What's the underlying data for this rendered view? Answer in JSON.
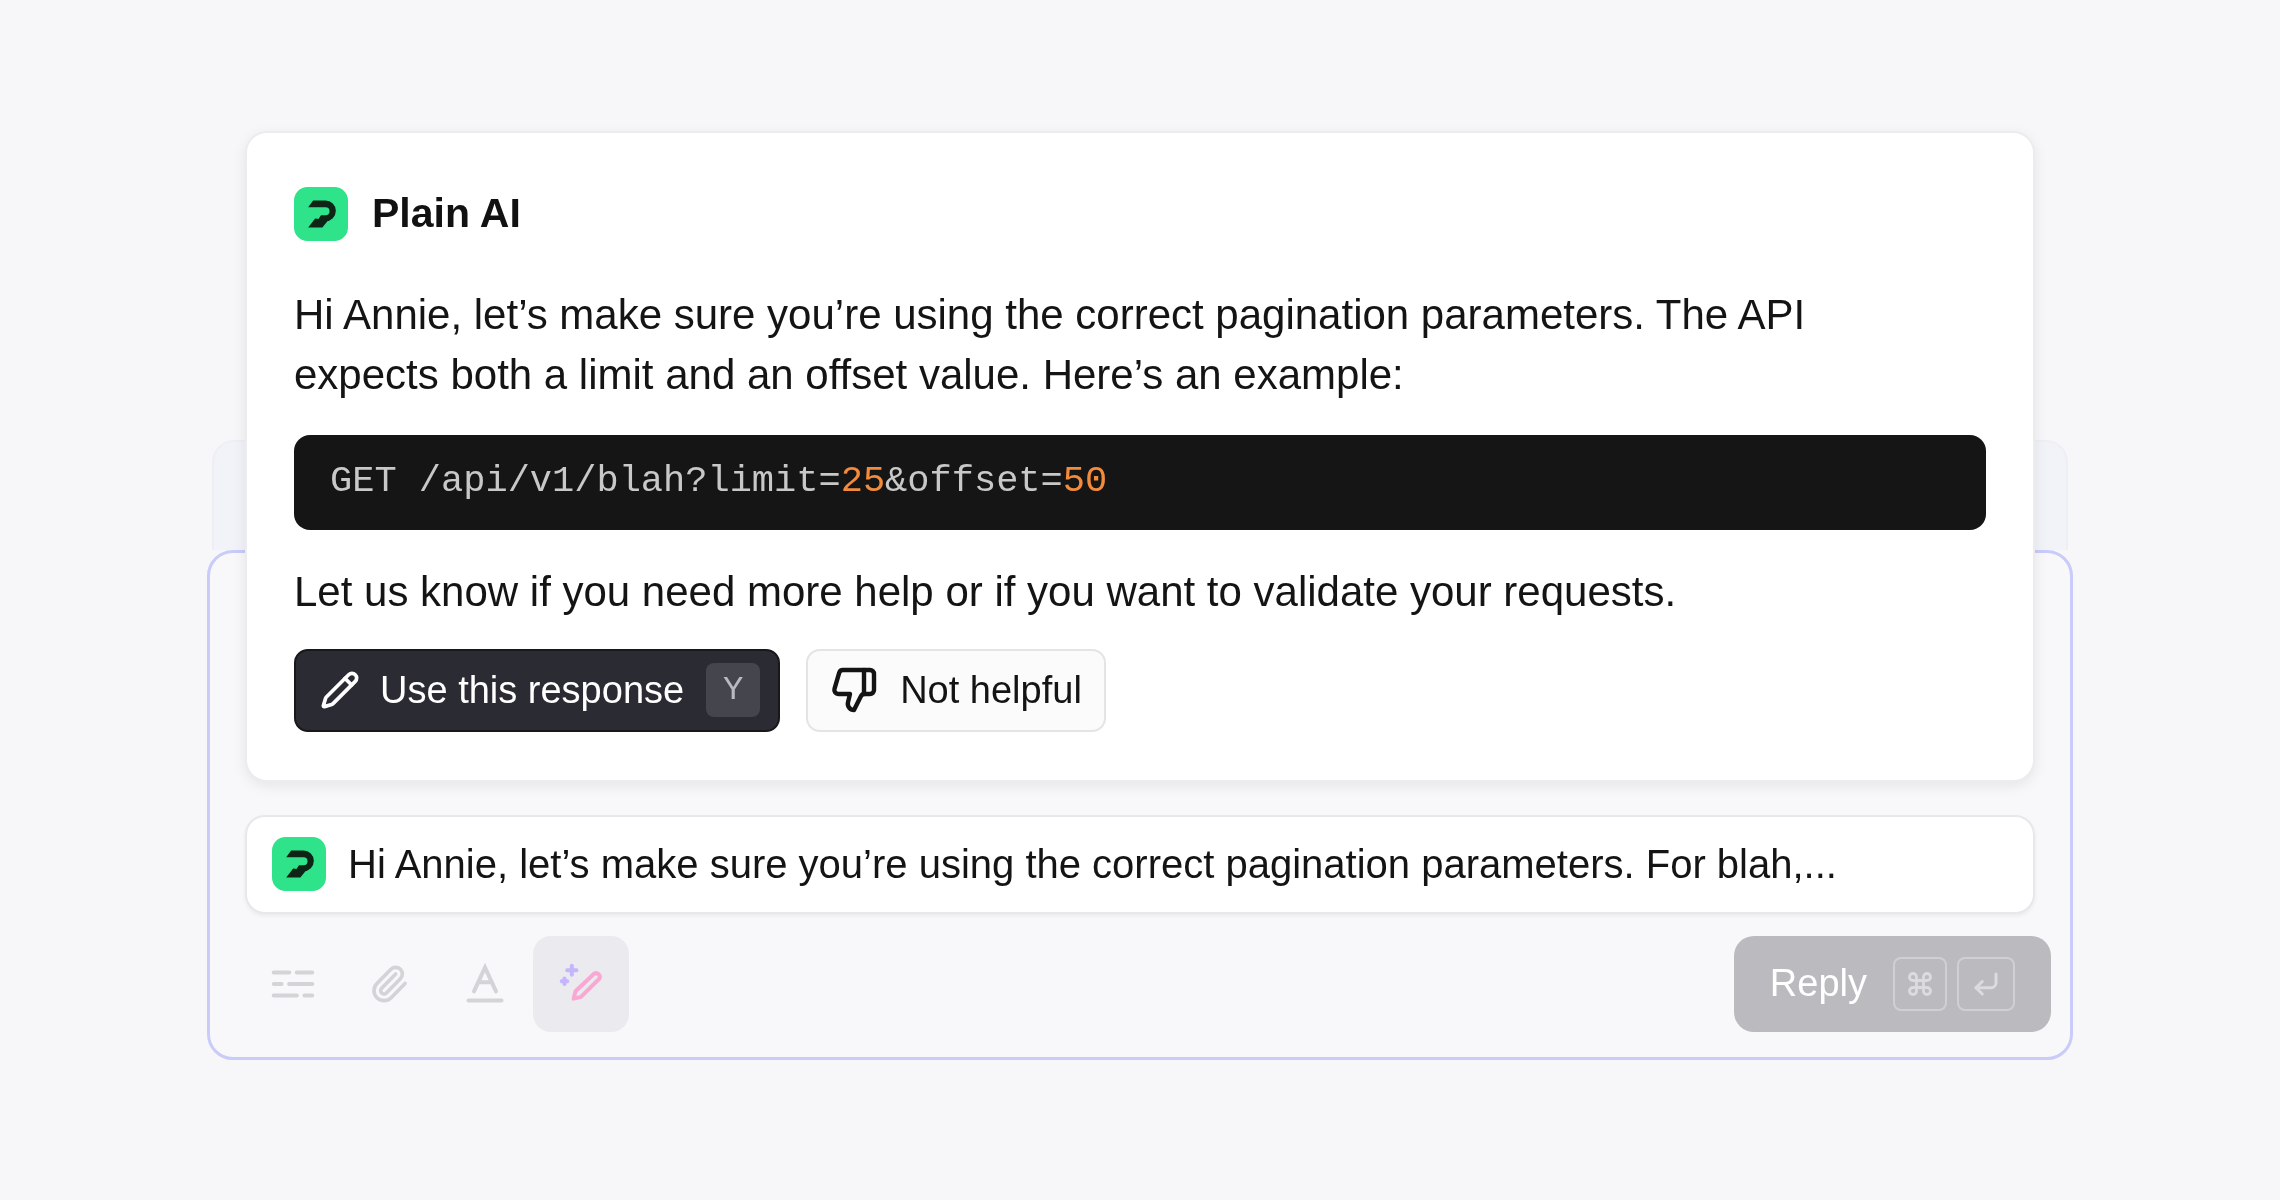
{
  "assistant": {
    "name": "Plain AI",
    "message": "Hi Annie, let’s make sure you’re using the correct pagination parameters. The API expects both a limit and an offset value. Here’s an example:",
    "code": [
      {
        "kind": "plain",
        "text": "GET /api/v1/blah?limit="
      },
      {
        "kind": "number",
        "text": "25"
      },
      {
        "kind": "plain",
        "text": "&offset="
      },
      {
        "kind": "number",
        "text": "50"
      }
    ],
    "followup": "Let us know if you need more help or if you want to validate your requests.",
    "actions": [
      {
        "kind": "primary",
        "label": "Use this response",
        "shortcut": "Y"
      },
      {
        "kind": "secondary",
        "label": "Not helpful"
      }
    ]
  },
  "composer": {
    "draft": "Hi Annie, let’s make sure you’re using the correct pagination parameters. For blah,...",
    "toolbar": [
      {
        "kind": "options",
        "selected": false
      },
      {
        "kind": "attach",
        "selected": false
      },
      {
        "kind": "format",
        "selected": false
      },
      {
        "kind": "ai",
        "selected": true
      }
    ],
    "reply": {
      "label": "Reply",
      "disabled": true
    }
  }
}
